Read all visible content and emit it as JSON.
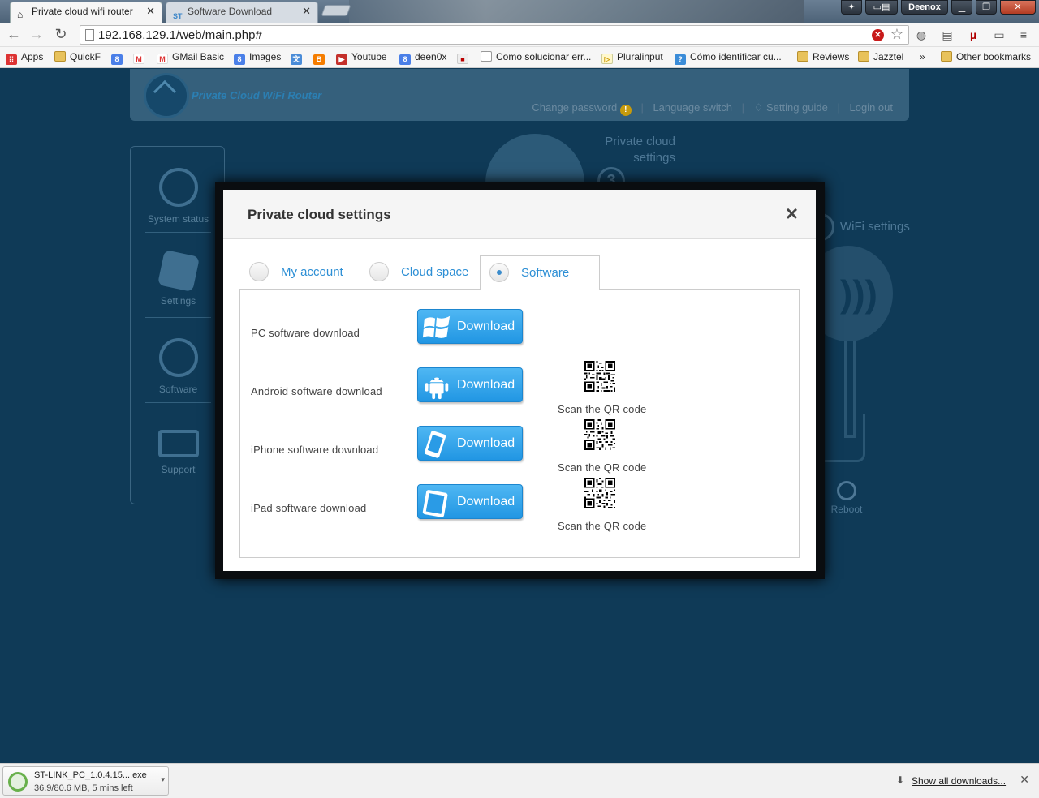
{
  "browser": {
    "tabs": [
      {
        "title": "Private cloud wifi router",
        "active": true
      },
      {
        "title": "Software Download",
        "active": false
      }
    ],
    "profile": "Deenox",
    "url": "192.168.129.1/web/main.php#",
    "bookmarks": [
      {
        "label": "Apps",
        "icon": "apps-grid-icon"
      },
      {
        "label": "QuickF",
        "icon": "folder-icon"
      },
      {
        "label": "",
        "icon": "google-icon"
      },
      {
        "label": "",
        "icon": "gmail-icon"
      },
      {
        "label": "GMail Basic",
        "icon": "gmail-icon"
      },
      {
        "label": "Images",
        "icon": "google-icon"
      },
      {
        "label": "",
        "icon": "translate-icon"
      },
      {
        "label": "",
        "icon": "blogger-icon"
      },
      {
        "label": "Youtube",
        "icon": "youtube-icon"
      },
      {
        "label": "deen0x",
        "icon": "google-icon"
      },
      {
        "label": "",
        "icon": "bookmark-icon"
      },
      {
        "label": "Como solucionar err...",
        "icon": "page-icon"
      },
      {
        "label": "Pluralinput",
        "icon": "page-icon"
      },
      {
        "label": "Cómo identificar cu...",
        "icon": "page-icon"
      },
      {
        "label": "Reviews",
        "icon": "folder-icon"
      },
      {
        "label": "Jazztel",
        "icon": "folder-icon"
      }
    ],
    "overflow": "»",
    "other_bookmarks": "Other bookmarks"
  },
  "app": {
    "brand": "Private Cloud WiFi Router",
    "header_links": [
      "Change password",
      "Language switch",
      "Setting guide",
      "Login out"
    ],
    "sidebar": [
      {
        "label": "System status",
        "icon": "pulse-icon"
      },
      {
        "label": "Settings",
        "icon": "gear-icon"
      },
      {
        "label": "Software",
        "icon": "cloud-download-icon"
      },
      {
        "label": "Support",
        "icon": "envelope-icon"
      }
    ],
    "background": {
      "private_cloud_line1": "Private cloud",
      "private_cloud_line2": "settings",
      "step3": "3",
      "step2": "2",
      "wifi_settings": "WiFi settings",
      "reboot": "Reboot"
    }
  },
  "modal": {
    "title": "Private cloud settings",
    "close": "×",
    "tabs": [
      {
        "label": "My account",
        "selected": false
      },
      {
        "label": "Cloud space",
        "selected": false
      },
      {
        "label": "Software",
        "selected": true
      }
    ],
    "rows": [
      {
        "label": "PC software download",
        "button": "Download",
        "icon": "windows-icon",
        "qr": null
      },
      {
        "label": "Android software download",
        "button": "Download",
        "icon": "android-icon",
        "qr": "Scan the QR code"
      },
      {
        "label": "iPhone software download",
        "button": "Download",
        "icon": "iphone-icon",
        "qr": "Scan the QR code"
      },
      {
        "label": "iPad software download",
        "button": "Download",
        "icon": "ipad-icon",
        "qr": "Scan the QR code"
      }
    ]
  },
  "downloads": {
    "file": "ST-LINK_PC_1.0.4.15....exe",
    "status": "36.9/80.6 MB, 5 mins left",
    "show_all": "Show all downloads..."
  },
  "colors": {
    "page_bg": "#0f3a57",
    "accent_blue": "#2d8fd5",
    "button_blue": "#2196e3"
  }
}
